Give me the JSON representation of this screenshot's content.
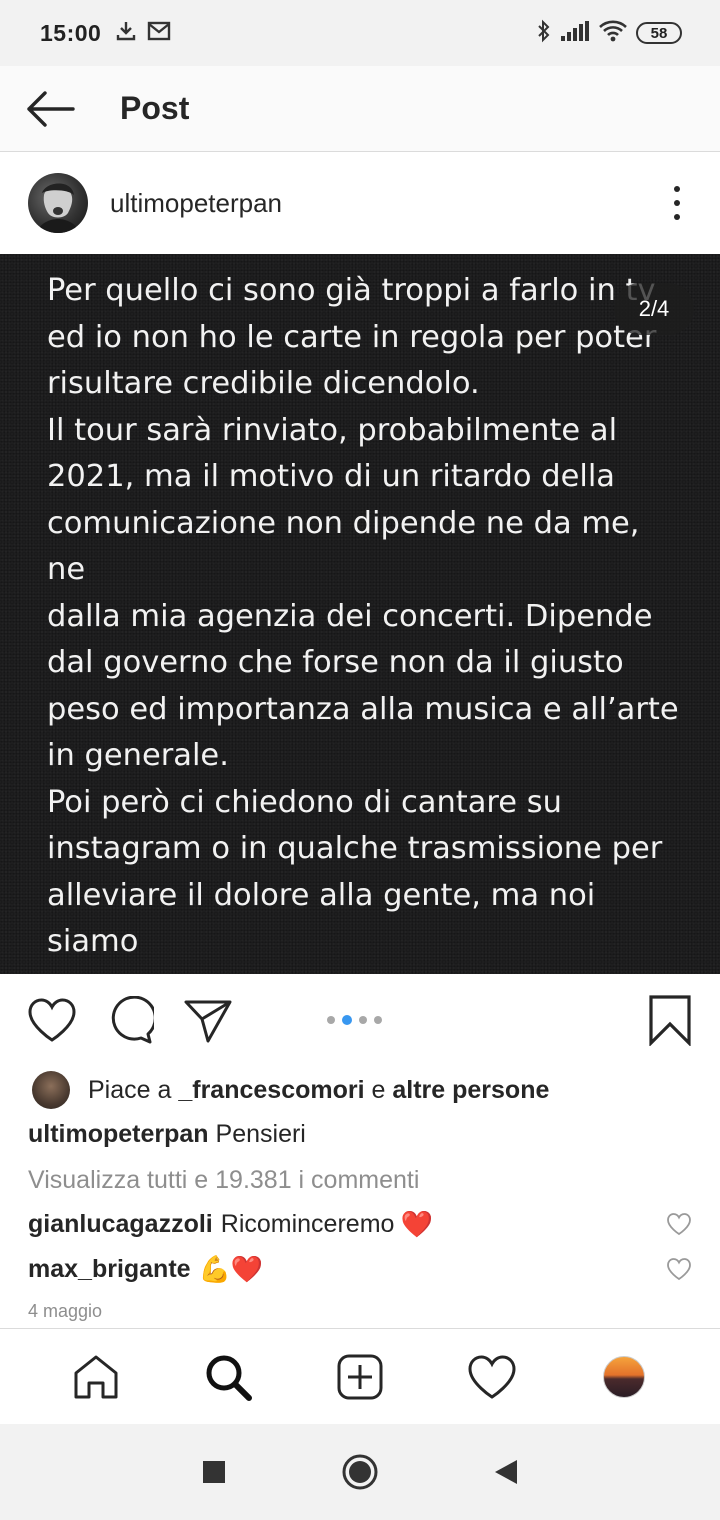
{
  "status_bar": {
    "time": "15:00",
    "left_icons": [
      "download-icon",
      "mail-icon"
    ],
    "right_icons": [
      "bluetooth-icon",
      "signal-icon",
      "wifi-icon"
    ],
    "battery": "58"
  },
  "header": {
    "title": "Post",
    "back_icon": "arrow-left-icon"
  },
  "post": {
    "author": "ultimopeterpan",
    "page_indicator": "2/4",
    "carousel": {
      "count": 4,
      "active_index": 1
    },
    "image_text": "Per quello ci sono già troppi a farlo in tv\ned io non ho le carte in regola per poter\nrisultare credibile dicendolo.\nIl tour sarà rinviato, probabilmente al\n2021, ma il motivo di un ritardo della\ncomunicazione non dipende ne da me, ne\ndalla mia agenzia dei concerti. Dipende\ndal governo che forse non da il giusto\npeso ed importanza alla musica e all’arte\nin generale.\nPoi però ci chiedono di cantare su\ninstagram o in qualche trasmissione per\nalleviare il dolore alla gente, ma noi siamo\nla gente, almeno io mi colloco tra voi, tra\nnoi.",
    "likes": {
      "prefix": "Piace a",
      "user": "_francescomori",
      "conjunction": "e",
      "others": "altre persone"
    },
    "caption": {
      "user": "ultimopeterpan",
      "text": "Pensieri"
    },
    "view_comments": "Visualizza tutti e 19.381 i commenti",
    "comments": [
      {
        "user": "gianlucagazzoli",
        "text": "Ricominceremo",
        "emoji": "❤️"
      },
      {
        "user": "max_brigante",
        "text": "",
        "emoji": "💪❤️"
      }
    ],
    "date": "4 maggio"
  },
  "bottom_nav": [
    "home-icon",
    "search-icon",
    "add-post-icon",
    "activity-heart-icon",
    "profile-avatar"
  ],
  "system_nav": [
    "recents-square-icon",
    "home-circle-icon",
    "back-triangle-icon"
  ],
  "colors": {
    "image_background": "#1e1e1f",
    "image_text": "#f2f2f2",
    "active_dot": "#3897f0",
    "muted_text": "#8e8e8e",
    "heart_red": "#e0262f"
  }
}
